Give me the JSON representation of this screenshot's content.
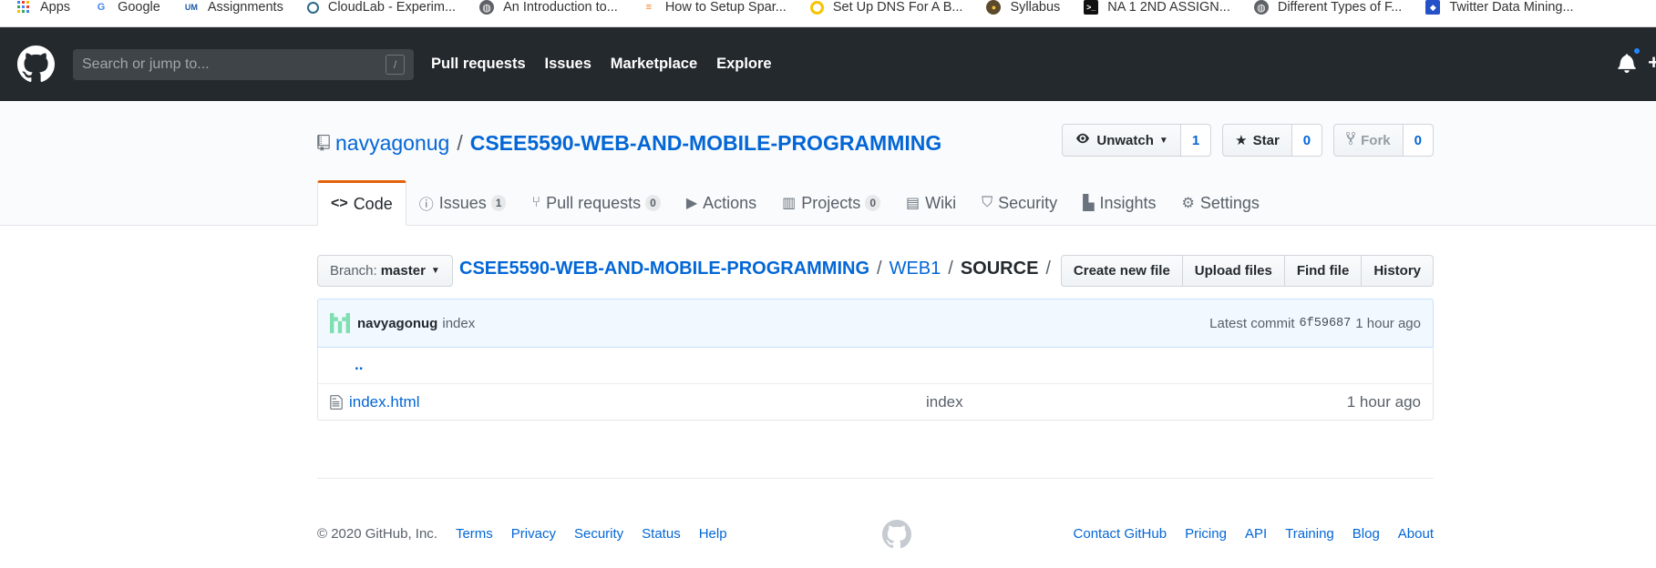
{
  "bookmarks": [
    {
      "label": "Apps",
      "icon": "apps-grid-icon"
    },
    {
      "label": "Google",
      "icon": "google-icon"
    },
    {
      "label": "Assignments",
      "icon": "umkc-icon"
    },
    {
      "label": "CloudLab - Experim...",
      "icon": "cloudlab-icon"
    },
    {
      "label": "An Introduction to...",
      "icon": "globe-icon"
    },
    {
      "label": "How to Setup Spar...",
      "icon": "stackoverflow-icon"
    },
    {
      "label": "Set Up DNS For A B...",
      "icon": "dns-icon"
    },
    {
      "label": "Syllabus",
      "icon": "syllabus-icon"
    },
    {
      "label": "NA 1 2ND ASSIGN...",
      "icon": "terminal-icon"
    },
    {
      "label": "Different Types of F...",
      "icon": "globe-icon"
    },
    {
      "label": "Twitter Data Mining...",
      "icon": "jira-icon"
    }
  ],
  "header": {
    "search_placeholder": "Search or jump to...",
    "search_shortcut": "/",
    "nav": [
      "Pull requests",
      "Issues",
      "Marketplace",
      "Explore"
    ]
  },
  "repo": {
    "owner": "navyagonug",
    "separator": "/",
    "name": "CSEE5590-WEB-AND-MOBILE-PROGRAMMING",
    "watch_label": "Unwatch",
    "watch_count": "1",
    "star_label": "Star",
    "star_count": "0",
    "fork_label": "Fork",
    "fork_count": "0"
  },
  "tabs": [
    {
      "label": "Code",
      "icon": "code-icon",
      "count": null,
      "selected": true
    },
    {
      "label": "Issues",
      "icon": "issue-icon",
      "count": "1"
    },
    {
      "label": "Pull requests",
      "icon": "pull-request-icon",
      "count": "0"
    },
    {
      "label": "Actions",
      "icon": "play-icon",
      "count": null
    },
    {
      "label": "Projects",
      "icon": "project-icon",
      "count": "0"
    },
    {
      "label": "Wiki",
      "icon": "book-icon",
      "count": null
    },
    {
      "label": "Security",
      "icon": "shield-icon",
      "count": null
    },
    {
      "label": "Insights",
      "icon": "graph-icon",
      "count": null
    },
    {
      "label": "Settings",
      "icon": "gear-icon",
      "count": null
    }
  ],
  "file_nav": {
    "branch_prefix": "Branch:",
    "branch": "master",
    "path_root": "CSEE5590-WEB-AND-MOBILE-PROGRAMMING",
    "path_mid": "WEB1",
    "path_final": "SOURCE",
    "sep": "/",
    "buttons": [
      "Create new file",
      "Upload files",
      "Find file",
      "History"
    ]
  },
  "commit": {
    "author": "navyagonug",
    "message": "index",
    "latest_label": "Latest commit",
    "sha": "6f59687",
    "age": "1 hour ago"
  },
  "files": {
    "parent": "..",
    "rows": [
      {
        "name": "index.html",
        "message": "index",
        "age": "1 hour ago"
      }
    ]
  },
  "footer": {
    "copyright": "© 2020 GitHub, Inc.",
    "left_links": [
      "Terms",
      "Privacy",
      "Security",
      "Status",
      "Help"
    ],
    "right_links": [
      "Contact GitHub",
      "Pricing",
      "API",
      "Training",
      "Blog",
      "About"
    ]
  },
  "colors": {
    "header_bg": "#24292e",
    "link": "#0366d6",
    "tab_accent": "#e36209",
    "commit_bg": "#f1f8ff",
    "notification_dot": "#2188ff"
  }
}
